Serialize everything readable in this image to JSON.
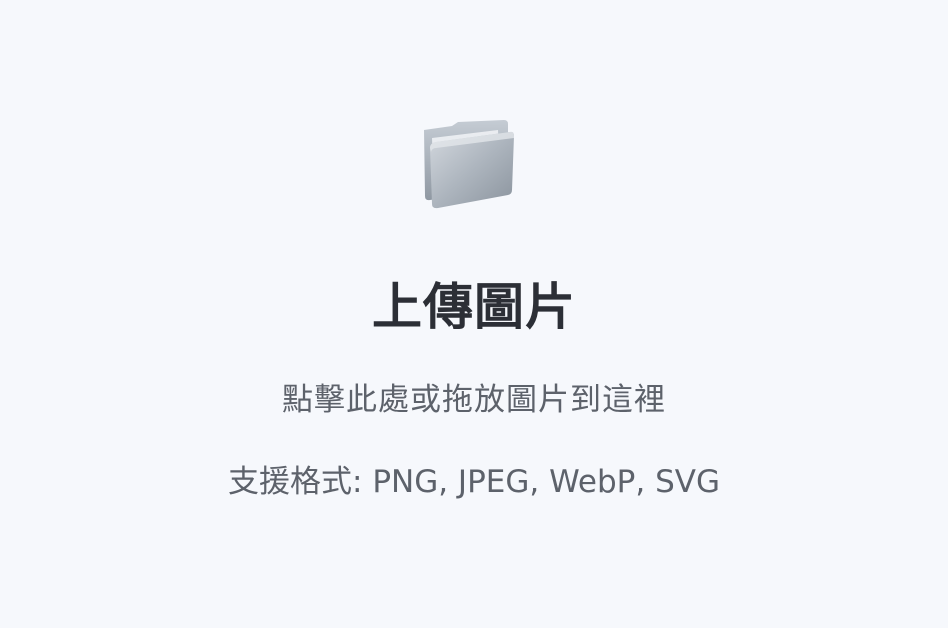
{
  "upload": {
    "icon": "folder-icon",
    "title": "上傳圖片",
    "instruction": "點擊此處或拖放圖片到這裡",
    "formats": "支援格式: PNG, JPEG, WebP, SVG"
  },
  "colors": {
    "background": "#f6f8fc",
    "title": "#2c2f36",
    "text": "#5d626b",
    "folder": "#9aa3ad"
  }
}
